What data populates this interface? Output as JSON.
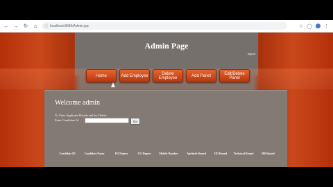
{
  "browser": {
    "url": "localhost:8084/Admin.jsp"
  },
  "page": {
    "title": "Admin Page",
    "logout_label": "logout"
  },
  "nav": {
    "items": [
      {
        "label": "Home"
      },
      {
        "label": "Add Employee"
      },
      {
        "label": "Delete Employee"
      },
      {
        "label": "Add Panel"
      },
      {
        "label": "Edit/Delete Panel"
      }
    ]
  },
  "content": {
    "welcome": "Welcome admin",
    "instruction": "To View Applicant Details and for Delete",
    "candidate_label": "Enter Candidate Id",
    "candidate_value": "",
    "go_label": "Go"
  },
  "table": {
    "headers": [
      "Candidate ID",
      "Candidate Name",
      "PG Degree",
      "UG Degree",
      "Mobile Number",
      "Aptitude Round",
      "GD Round",
      "Technical Round",
      "HR Round"
    ]
  }
}
